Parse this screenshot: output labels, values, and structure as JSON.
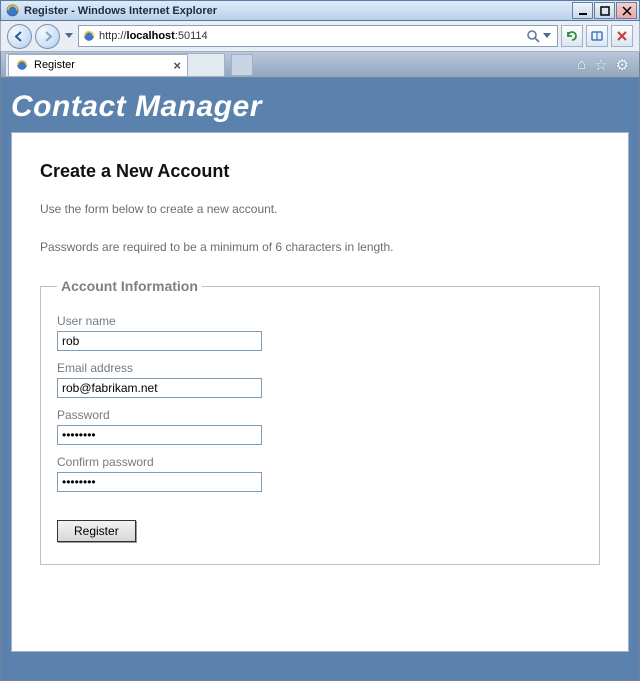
{
  "window": {
    "title": "Register - Windows Internet Explorer"
  },
  "address": {
    "scheme": "http://",
    "host": "localhost",
    "port_path": ":50114"
  },
  "tab": {
    "label": "Register"
  },
  "page": {
    "banner": "Contact Manager",
    "heading": "Create a New Account",
    "help1": "Use the form below to create a new account.",
    "help2": "Passwords are required to be a minimum of 6 characters in length.",
    "legend": "Account Information",
    "fields": {
      "username_label": "User name",
      "username_value": "rob",
      "email_label": "Email address",
      "email_value": "rob@fabrikam.net",
      "password_label": "Password",
      "password_value": "••••••••",
      "confirm_label": "Confirm password",
      "confirm_value": "••••••••"
    },
    "submit": "Register"
  }
}
